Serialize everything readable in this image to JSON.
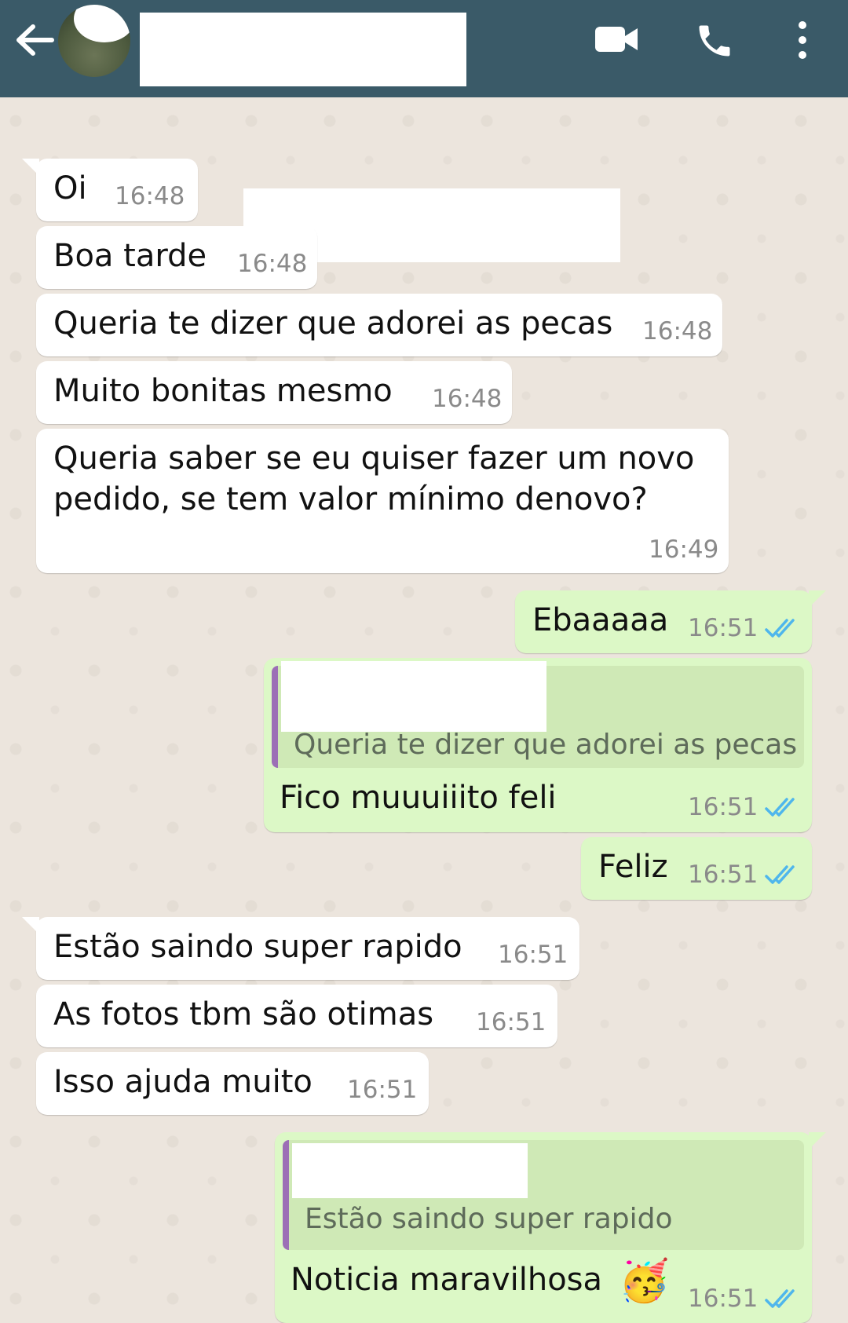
{
  "header": {
    "back_icon": "arrow-left-icon",
    "video_icon": "video-camera-icon",
    "call_icon": "phone-icon",
    "menu_icon": "more-vertical-icon",
    "colors": {
      "bar": "#3a5a68",
      "icons": "#ffffff"
    }
  },
  "messages": [
    {
      "dir": "in",
      "text": "Oi",
      "time": "16:48"
    },
    {
      "dir": "in",
      "text": "Boa tarde",
      "time": "16:48"
    },
    {
      "dir": "in",
      "text": "Queria te dizer que adorei as pecas",
      "time": "16:48"
    },
    {
      "dir": "in",
      "text": "Muito bonitas mesmo",
      "time": "16:48"
    },
    {
      "dir": "in",
      "line1": "Queria saber se eu quiser fazer um novo",
      "line2": "pedido, se tem valor mínimo denovo?",
      "time": "16:49"
    },
    {
      "dir": "out",
      "text": "Ebaaaaa",
      "time": "16:51"
    },
    {
      "dir": "out",
      "quote": "Queria te dizer que adorei as pecas",
      "text": "Fico muuuiiito feli",
      "time": "16:51"
    },
    {
      "dir": "out",
      "text": "Feliz",
      "time": "16:51"
    },
    {
      "dir": "in",
      "text": "Estão saindo super rapido",
      "time": "16:51"
    },
    {
      "dir": "in",
      "text": "As fotos tbm são otimas",
      "time": "16:51"
    },
    {
      "dir": "in",
      "text": "Isso ajuda muito",
      "time": "16:51"
    },
    {
      "dir": "out",
      "quote": "Estão saindo super rapido",
      "text": "Noticia maravilhosa",
      "emoji": "🥳",
      "time": "16:51"
    }
  ],
  "colors": {
    "incoming_bubble": "#ffffff",
    "outgoing_bubble": "#dcf8c6",
    "quote_bar": "#9c6fb6",
    "read_ticks": "#4fb6ec",
    "wallpaper": "#ece5dd"
  }
}
